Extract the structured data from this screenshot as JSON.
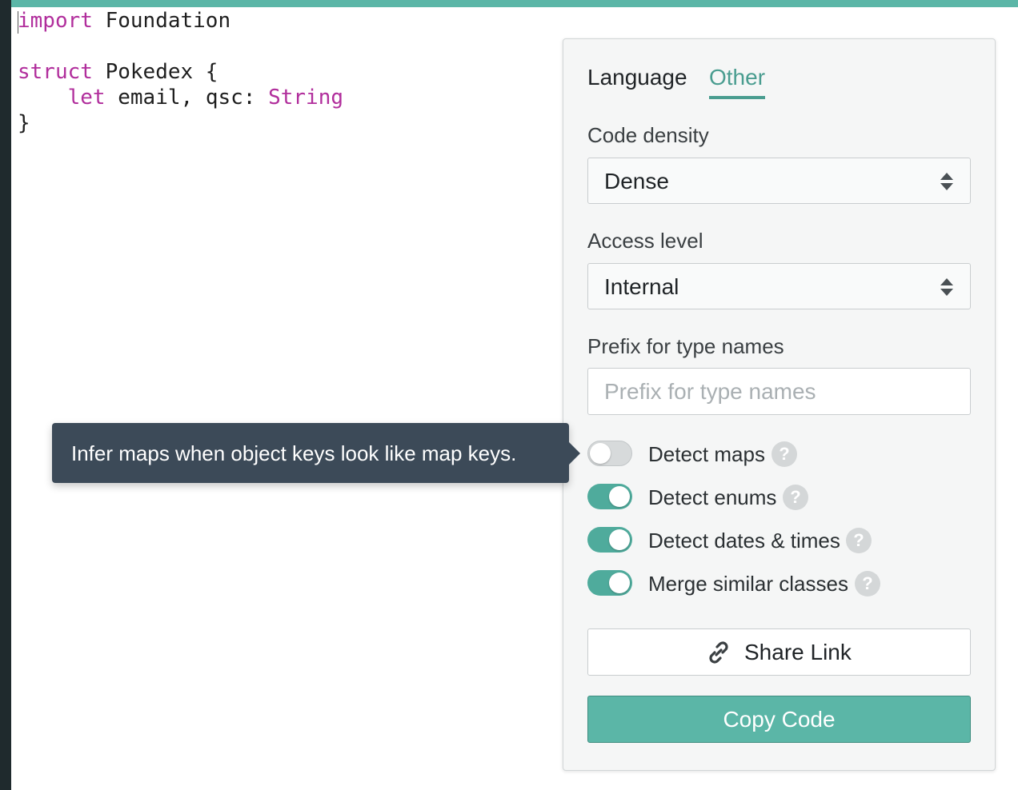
{
  "editor": {
    "lines": [
      [
        {
          "t": "import",
          "c": "kw"
        },
        {
          "t": " Foundation",
          "c": ""
        }
      ],
      [],
      [
        {
          "t": "struct",
          "c": "kw"
        },
        {
          "t": " Pokedex {",
          "c": ""
        }
      ],
      [
        {
          "t": "    ",
          "c": ""
        },
        {
          "t": "let",
          "c": "kw"
        },
        {
          "t": " email, qsc: ",
          "c": ""
        },
        {
          "t": "String",
          "c": "tp"
        }
      ],
      [
        {
          "t": "}",
          "c": ""
        }
      ]
    ]
  },
  "tabs": {
    "language": "Language",
    "other": "Other",
    "active": "other"
  },
  "code_density": {
    "label": "Code density",
    "value": "Dense"
  },
  "access_level": {
    "label": "Access level",
    "value": "Internal"
  },
  "prefix": {
    "label": "Prefix for type names",
    "placeholder": "Prefix for type names",
    "value": ""
  },
  "toggles": [
    {
      "label": "Detect maps",
      "on": false,
      "help_icon": "question-icon"
    },
    {
      "label": "Detect enums",
      "on": true,
      "help_icon": "question-icon"
    },
    {
      "label": "Detect dates & times",
      "on": true,
      "help_icon": "question-icon"
    },
    {
      "label": "Merge similar classes",
      "on": true,
      "help_icon": "question-icon"
    }
  ],
  "buttons": {
    "share_label": "Share Link",
    "share_icon": "link-icon",
    "copy_label": "Copy Code"
  },
  "tooltip": {
    "text": "Infer maps when object keys look like map keys."
  },
  "colors": {
    "accent": "#5bb6a7",
    "accent_text": "#4a9d90",
    "keyword": "#b12e9c",
    "tooltip_bg": "#3c4a58"
  }
}
